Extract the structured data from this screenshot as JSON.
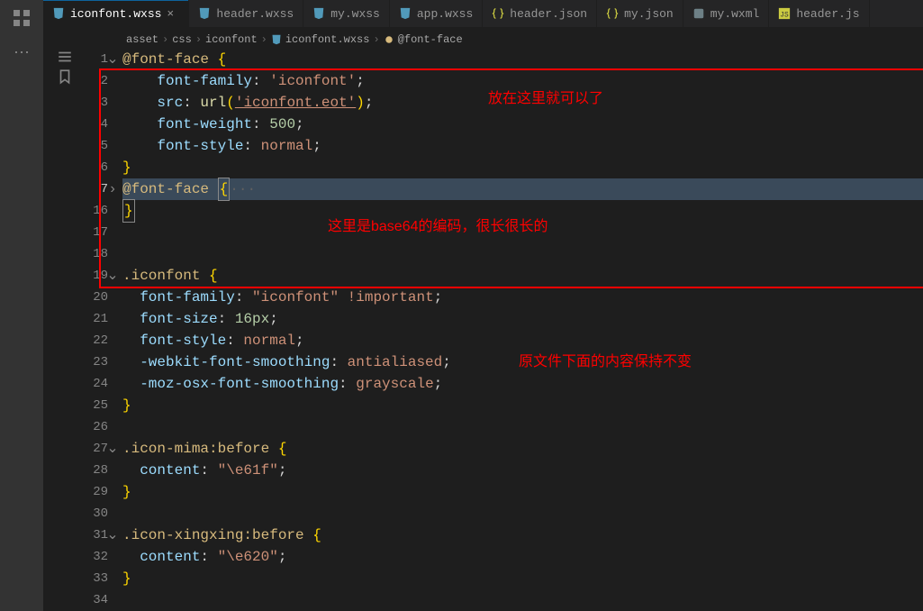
{
  "tabs": [
    {
      "icon": "css",
      "label": "iconfont.wxss",
      "active": true,
      "close": true
    },
    {
      "icon": "css",
      "label": "header.wxss"
    },
    {
      "icon": "css",
      "label": "my.wxss"
    },
    {
      "icon": "css",
      "label": "app.wxss"
    },
    {
      "icon": "json",
      "label": "header.json"
    },
    {
      "icon": "json",
      "label": "my.json"
    },
    {
      "icon": "wxml",
      "label": "my.wxml"
    },
    {
      "icon": "js",
      "label": "header.js"
    }
  ],
  "breadcrumb": {
    "p1": "asset",
    "p2": "css",
    "p3": "iconfont",
    "p4": "iconfont.wxss",
    "p5": "@font-face"
  },
  "lines": {
    "l1": [
      "1",
      "2",
      "3",
      "4",
      "5",
      "6",
      "7",
      "16",
      "17",
      "18",
      "19",
      "20",
      "21",
      "22",
      "23",
      "24",
      "25",
      "26",
      "27",
      "28",
      "29",
      "30",
      "31",
      "32",
      "33",
      "34"
    ]
  },
  "code": {
    "t1a": "@font-face ",
    "t1b": "{",
    "t2a": "    font-family",
    "t2b": ": ",
    "t2c": "'iconfont'",
    "t2d": ";",
    "t3a": "    src",
    "t3b": ": ",
    "t3c": "url",
    "t3d": "(",
    "t3e": "'iconfont.eot'",
    "t3f": ")",
    "t3g": ";",
    "t4a": "    font-weight",
    "t4b": ": ",
    "t4c": "500",
    "t4d": ";",
    "t5a": "    font-style",
    "t5b": ": ",
    "t5c": "normal",
    "t5d": ";",
    "t6a": "}",
    "t7a": "@font-face ",
    "t7b": "{",
    "t7c": "···",
    "t16a": "}",
    "t19a": ".iconfont ",
    "t19b": "{",
    "t20a": "  font-family",
    "t20b": ": ",
    "t20c": "\"iconfont\"",
    "t20d": " !important",
    "t20e": ";",
    "t21a": "  font-size",
    "t21b": ": ",
    "t21c": "16px",
    "t21d": ";",
    "t22a": "  font-style",
    "t22b": ": ",
    "t22c": "normal",
    "t22d": ";",
    "t23a": "  -webkit-font-smoothing",
    "t23b": ": ",
    "t23c": "antialiased",
    "t23d": ";",
    "t24a": "  -moz-osx-font-smoothing",
    "t24b": ": ",
    "t24c": "grayscale",
    "t24d": ";",
    "t25a": "}",
    "t27a": ".icon-mima",
    "t27b": ":before ",
    "t27c": "{",
    "t28a": "  content",
    "t28b": ": ",
    "t28c": "\"\\e61f\"",
    "t28d": ";",
    "t29a": "}",
    "t31a": ".icon-xingxing",
    "t31b": ":before ",
    "t31c": "{",
    "t32a": "  content",
    "t32b": ": ",
    "t32c": "\"\\e620\"",
    "t32d": ";",
    "t33a": "}"
  },
  "annotations": {
    "a1": "放在这里就可以了",
    "a2": "这里是base64的编码，很长很长的",
    "a3": "原文件下面的内容保持不变"
  }
}
